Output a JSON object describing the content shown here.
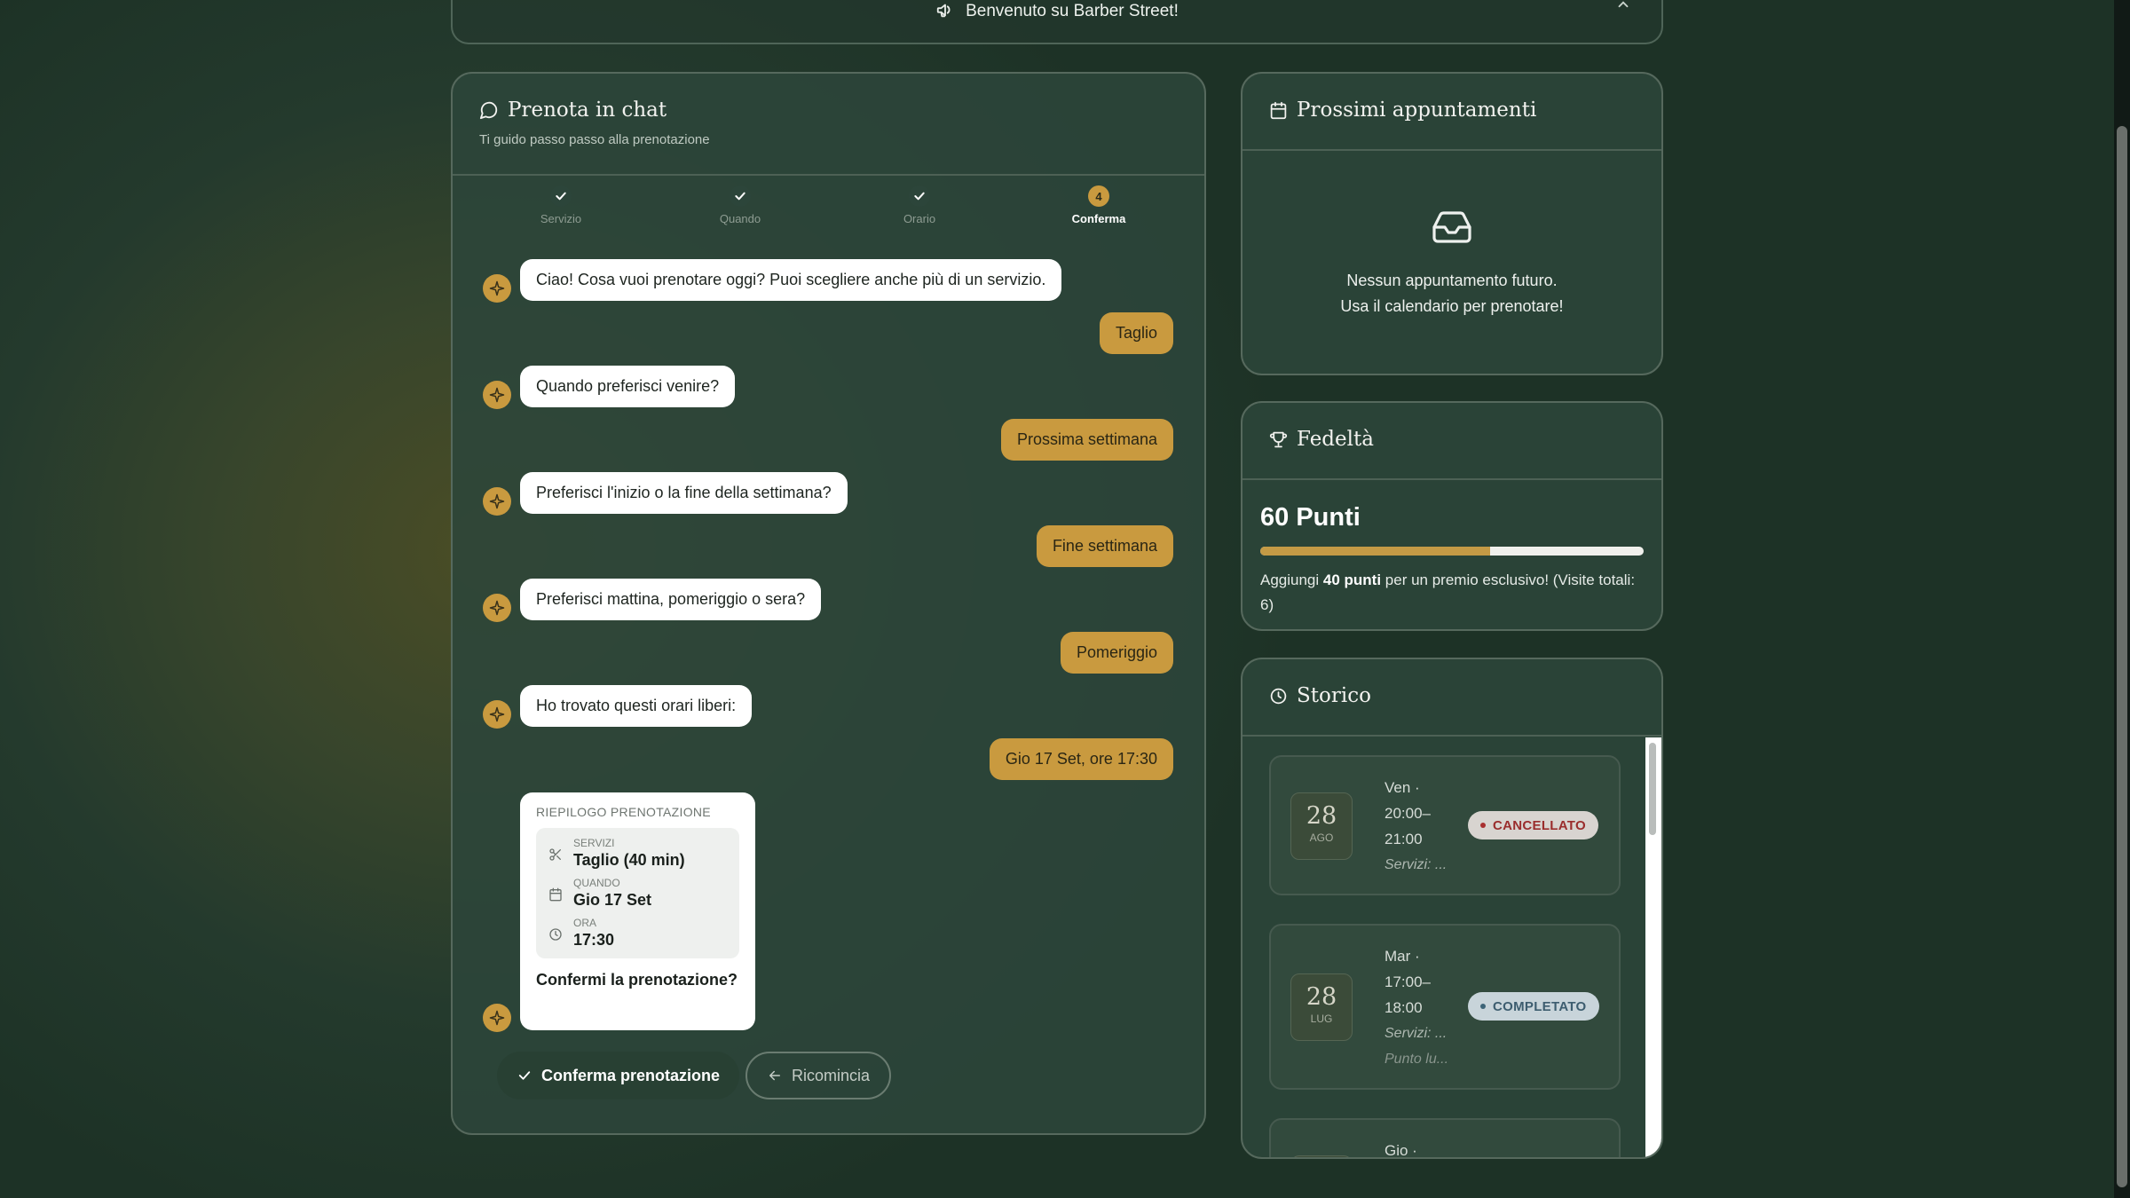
{
  "announcement": {
    "text": "Benvenuto su Barber Street!"
  },
  "chat": {
    "title": "Prenota in chat",
    "subtitle": "Ti guido passo passo alla prenotazione",
    "steps": [
      {
        "label": "Servizio",
        "state": "done"
      },
      {
        "label": "Quando",
        "state": "done"
      },
      {
        "label": "Orario",
        "state": "done"
      },
      {
        "label": "Conferma",
        "number": "4",
        "state": "active"
      }
    ],
    "messages": [
      {
        "from": "bot",
        "text": "Ciao! Cosa vuoi prenotare oggi? Puoi scegliere anche più di un servizio."
      },
      {
        "from": "user",
        "text": "Taglio"
      },
      {
        "from": "bot",
        "text": "Quando preferisci venire?"
      },
      {
        "from": "user",
        "text": "Prossima settimana"
      },
      {
        "from": "bot",
        "text": "Preferisci l'inizio o la fine della settimana?"
      },
      {
        "from": "user",
        "text": "Fine settimana"
      },
      {
        "from": "bot",
        "text": "Preferisci mattina, pomeriggio o sera?"
      },
      {
        "from": "user",
        "text": "Pomeriggio"
      },
      {
        "from": "bot",
        "text": "Ho trovato questi orari liberi:"
      },
      {
        "from": "user",
        "text": "Gio 17 Set, ore 17:30"
      }
    ],
    "summary": {
      "heading": "RIEPILOGO PRENOTAZIONE",
      "services_label": "SERVIZI",
      "services_value": "Taglio (40 min)",
      "when_label": "QUANDO",
      "when_value": "Gio 17 Set",
      "time_label": "ORA",
      "time_value": "17:30",
      "question": "Confermi la prenotazione?"
    },
    "confirm_label": "Conferma prenotazione",
    "restart_label": "Ricomincia"
  },
  "appointments": {
    "title": "Prossimi appuntamenti",
    "empty_line1": "Nessun appuntamento futuro.",
    "empty_line2": "Usa il calendario per prenotare!"
  },
  "loyalty": {
    "title": "Fedeltà",
    "points_text": "60 Punti",
    "progress_fraction": 0.6,
    "note_prefix": "Aggiungi ",
    "note_bold": "40 punti",
    "note_suffix": " per un premio esclusivo! (Visite totali: 6)"
  },
  "history": {
    "title": "Storico",
    "items": [
      {
        "day": "28",
        "month": "AGO",
        "weekday": "Ven ·",
        "time1": "20:00–",
        "time2": "21:00",
        "services": "Servizi: ...",
        "status": "CANCELLATO"
      },
      {
        "day": "28",
        "month": "LUG",
        "weekday": "Mar ·",
        "time1": "17:00–",
        "time2": "18:00",
        "services": "Servizi: ...",
        "extra": "Punto lu...",
        "status": "COMPLETATO"
      },
      {
        "weekday": "Gio ·"
      }
    ]
  },
  "colors": {
    "accent": "#c99a3f",
    "panel": "#2c453a",
    "background": "#243a2d"
  }
}
